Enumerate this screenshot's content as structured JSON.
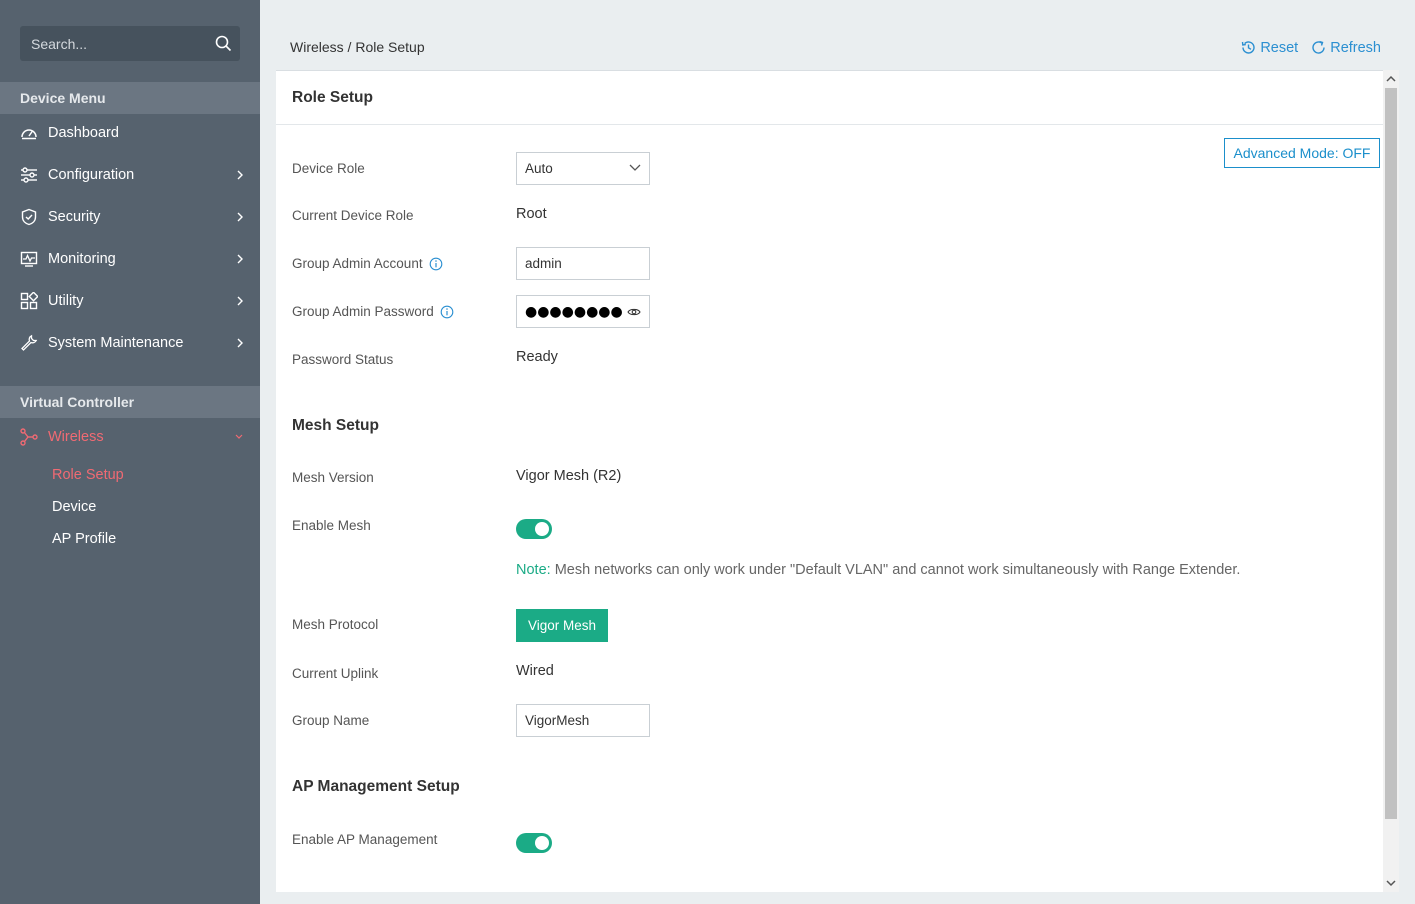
{
  "search": {
    "placeholder": "Search..."
  },
  "sidebar": {
    "device_menu_header": "Device Menu",
    "items": [
      {
        "label": "Dashboard",
        "icon": "dashboard-icon"
      },
      {
        "label": "Configuration",
        "icon": "sliders-icon"
      },
      {
        "label": "Security",
        "icon": "shield-icon"
      },
      {
        "label": "Monitoring",
        "icon": "monitor-icon"
      },
      {
        "label": "Utility",
        "icon": "grid-icon"
      },
      {
        "label": "System Maintenance",
        "icon": "wrench-icon"
      }
    ],
    "vc_header": "Virtual Controller",
    "wireless": {
      "label": "Wireless",
      "icon": "network-icon"
    },
    "sub_items": [
      {
        "label": "Role Setup"
      },
      {
        "label": "Device"
      },
      {
        "label": "AP Profile"
      }
    ]
  },
  "header": {
    "breadcrumb": "Wireless / Role Setup",
    "reset_label": "Reset",
    "refresh_label": "Refresh"
  },
  "panel": {
    "title": "Role Setup",
    "advanced_mode_label": "Advanced Mode: OFF",
    "role": {
      "device_role_label": "Device Role",
      "device_role_value": "Auto",
      "current_role_label": "Current Device Role",
      "current_role_value": "Root",
      "admin_account_label": "Group Admin Account",
      "admin_account_value": "admin",
      "admin_password_label": "Group Admin Password",
      "admin_password_value": "●●●●●●●●●",
      "password_status_label": "Password Status",
      "password_status_value": "Ready"
    },
    "mesh": {
      "title": "Mesh Setup",
      "version_label": "Mesh Version",
      "version_value": "Vigor Mesh (R2)",
      "enable_label": "Enable Mesh",
      "enable_on": true,
      "note_label": "Note:",
      "note_text": " Mesh networks can only work under \"Default VLAN\" and cannot work simultaneously with Range Extender.",
      "protocol_label": "Mesh Protocol",
      "protocol_value": "Vigor Mesh",
      "uplink_label": "Current Uplink",
      "uplink_value": "Wired",
      "group_name_label": "Group Name",
      "group_name_value": "VigorMesh"
    },
    "ap": {
      "title": "AP Management Setup",
      "enable_label": "Enable AP Management",
      "enable_on": true
    }
  },
  "colors": {
    "sidebar_bg": "#56626e",
    "active_red": "#f06a73",
    "accent_blue": "#2b8fd1",
    "accent_green": "#1bab86"
  }
}
